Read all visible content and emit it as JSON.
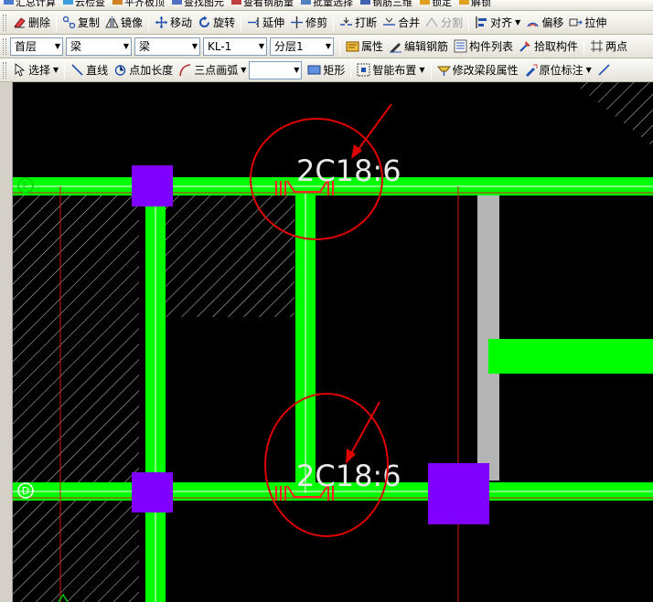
{
  "top_partial": {
    "items": [
      "汇总计算",
      "云检查",
      "平齐板顶",
      "查找图元",
      "查看钢筋量",
      "批量选择",
      "钢筋三维",
      "锁定",
      "解锁"
    ]
  },
  "edit_toolbar": {
    "delete": "删除",
    "copy": "复制",
    "mirror": "镜像",
    "move": "移动",
    "rotate": "旋转",
    "extend": "延伸",
    "trim": "修剪",
    "break": "打断",
    "merge": "合并",
    "split": "分割",
    "align": "对齐",
    "offset": "偏移",
    "stretch": "拉伸"
  },
  "layer_toolbar": {
    "floor": "首层",
    "category": "梁",
    "type": "梁",
    "component": "KL-1",
    "sublayer": "分层1",
    "properties": "属性",
    "edit_rebar": "编辑钢筋",
    "component_list": "构件列表",
    "pick_component": "拾取构件",
    "two_points": "两点"
  },
  "draw_toolbar": {
    "select": "选择",
    "line": "直线",
    "point_length": "点加长度",
    "three_point_arc": "三点画弧",
    "arc_combo_value": "",
    "rectangle": "矩形",
    "smart_layout": "智能布置",
    "modify_beam_segment": "修改梁段属性",
    "in_place_annotation": "原位标注"
  },
  "canvas": {
    "axis_labels": [
      "E",
      "D"
    ],
    "rebar_labels": [
      "2C18:6",
      "2C18:6"
    ],
    "colors": {
      "background": "#000000",
      "beam": "#00ff00",
      "column": "#8000ff",
      "grid_line": "#d01818",
      "axis_line": "#ffffff",
      "markup": "#e00000",
      "wall": "#b4b4b4",
      "rebar_text": "#e8e8e8"
    }
  }
}
